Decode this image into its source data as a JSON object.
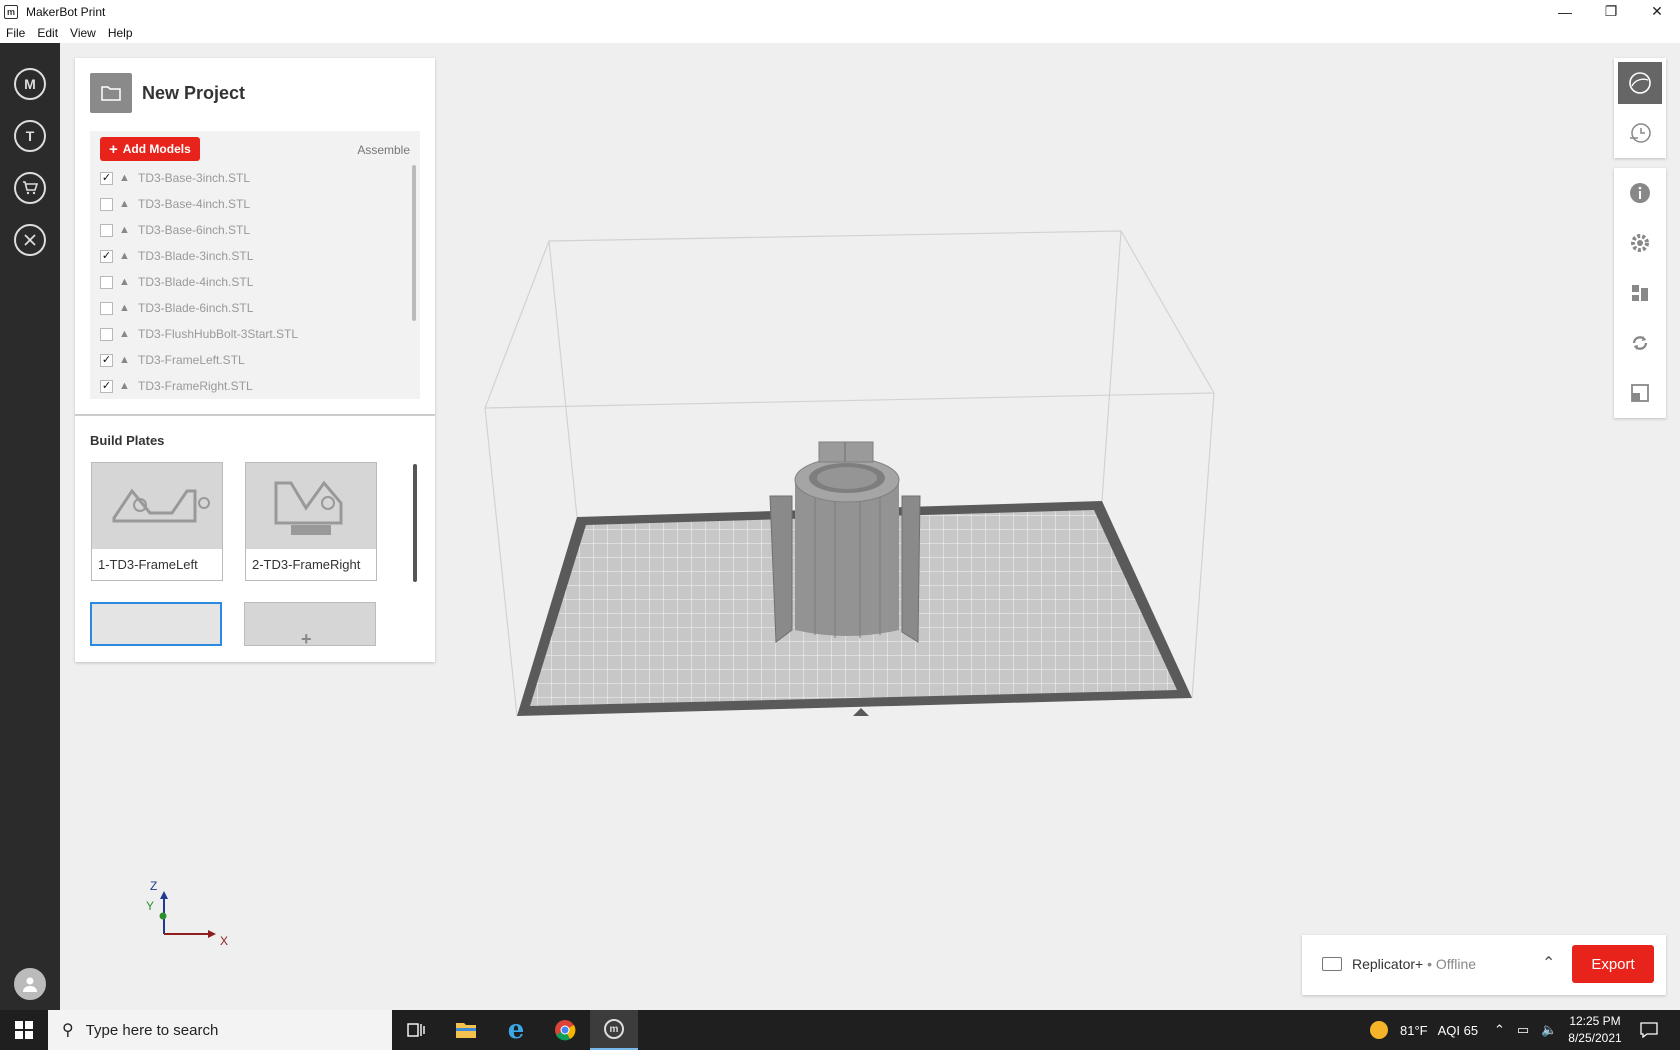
{
  "window": {
    "title": "MakerBot Print"
  },
  "menu": [
    "File",
    "Edit",
    "View",
    "Help"
  ],
  "leftnav": {
    "items": [
      {
        "icon": "makerbot-logo-icon",
        "label": "M"
      },
      {
        "icon": "thingiverse-icon",
        "label": "T"
      },
      {
        "icon": "store-cart-icon",
        "label": ""
      },
      {
        "icon": "utilities-icon",
        "label": ""
      }
    ]
  },
  "project": {
    "title": "New Project",
    "add_models_label": "Add Models",
    "assemble_label": "Assemble",
    "models": [
      {
        "name": "TD3-Base-3inch.STL",
        "checked": true
      },
      {
        "name": "TD3-Base-4inch.STL",
        "checked": false
      },
      {
        "name": "TD3-Base-6inch.STL",
        "checked": false
      },
      {
        "name": "TD3-Blade-3inch.STL",
        "checked": true
      },
      {
        "name": "TD3-Blade-4inch.STL",
        "checked": false
      },
      {
        "name": "TD3-Blade-6inch.STL",
        "checked": false
      },
      {
        "name": "TD3-FlushHubBolt-3Start.STL",
        "checked": false
      },
      {
        "name": "TD3-FrameLeft.STL",
        "checked": true
      },
      {
        "name": "TD3-FrameRight.STL",
        "checked": true
      }
    ],
    "build_plates_title": "Build Plates",
    "build_plates": [
      {
        "label": "1-TD3-FrameLeft"
      },
      {
        "label": "2-TD3-FrameRight"
      }
    ]
  },
  "axis": {
    "z": "Z",
    "y": "Y",
    "x": "X"
  },
  "printer": {
    "name": "Replicator+",
    "status": " • Offline",
    "export_label": "Export"
  },
  "taskbar": {
    "search_placeholder": "Type here to search",
    "weather": "81°F",
    "aqi": "AQI 65",
    "time": "12:25 PM",
    "date": "8/25/2021"
  }
}
